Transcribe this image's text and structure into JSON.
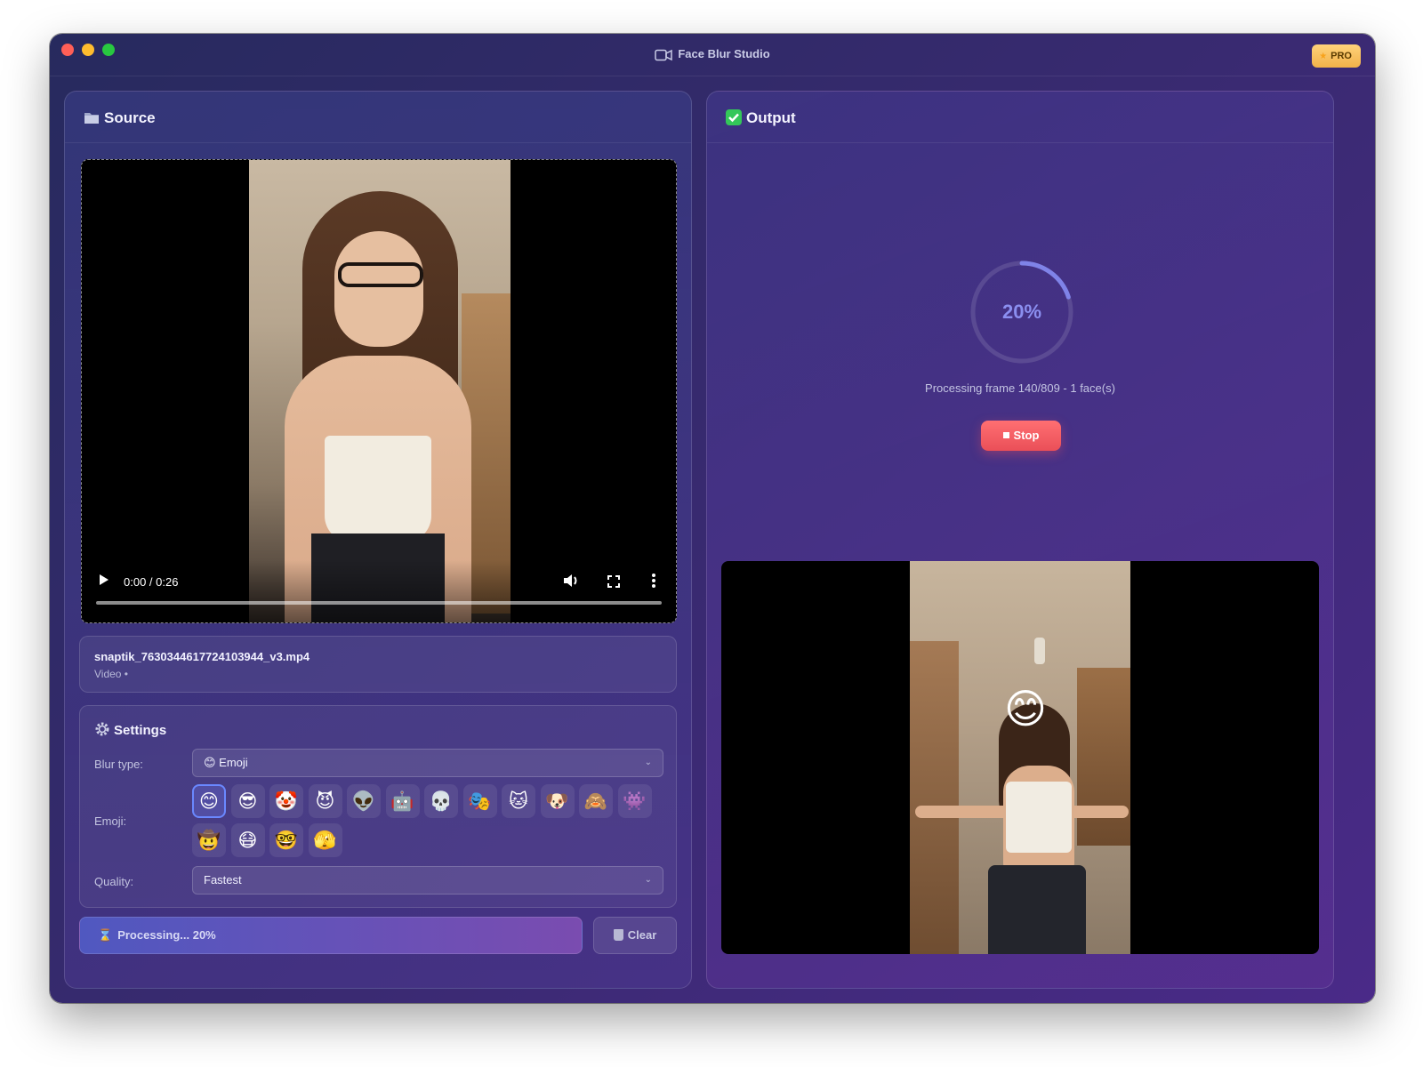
{
  "window": {
    "title": "Face Blur Studio",
    "badge": "PRO"
  },
  "source": {
    "title": "Source",
    "player": {
      "time": "0:00 / 0:26"
    },
    "file": {
      "name": "snaptik_7630344617724103944_v3.mp4",
      "meta": "Video •"
    },
    "settings": {
      "title": "Settings",
      "blur_type": {
        "label": "Blur type:",
        "value": "😊 Emoji"
      },
      "emoji": {
        "label": "Emoji:",
        "selected": "😊",
        "options": [
          "😊",
          "😎",
          "🤡",
          "😈",
          "👽",
          "🤖",
          "💀",
          "🎭",
          "🐱",
          "🐶",
          "🙈",
          "👾",
          "🤠",
          "😷",
          "🤓",
          "🫣"
        ]
      },
      "quality": {
        "label": "Quality:",
        "value": "Fastest"
      }
    },
    "actions": {
      "processing": "Processing... 20%",
      "clear": "Clear"
    }
  },
  "output": {
    "title": "Output",
    "progress_percent": 20,
    "progress_label": "20%",
    "status": "Processing frame 140/809 - 1 face(s)",
    "stop": "Stop",
    "face_emoji": "😊"
  },
  "colors": {
    "accent": "#6a88ff",
    "stop": "#ea4f58",
    "badge": "#f2b24a",
    "ring": "#7f83e8"
  }
}
